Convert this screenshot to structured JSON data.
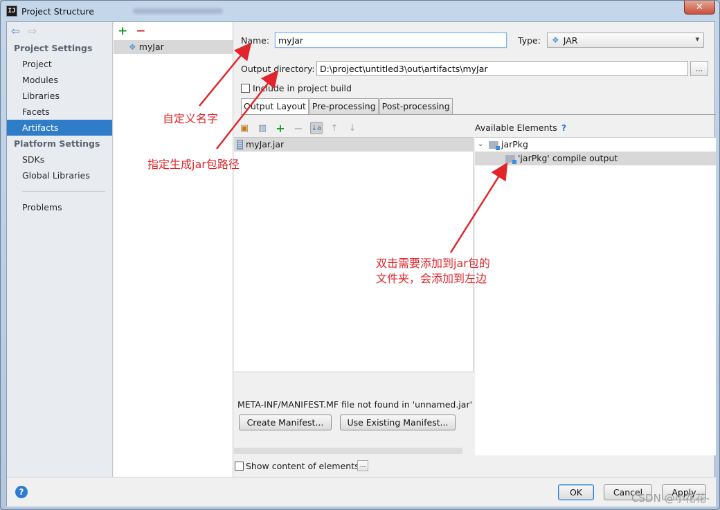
{
  "window": {
    "title": "Project Structure",
    "app_icon_text": "IJ",
    "close_glyph": "✕"
  },
  "nav": {
    "back_glyph": "⇦",
    "fwd_glyph": "⇨",
    "project_settings_header": "Project Settings",
    "project_items": [
      "Project",
      "Modules",
      "Libraries",
      "Facets",
      "Artifacts"
    ],
    "selected_item": "Artifacts",
    "platform_settings_header": "Platform Settings",
    "platform_items": [
      "SDKs",
      "Global Libraries"
    ],
    "problems": "Problems"
  },
  "artifacts": {
    "add_glyph": "+",
    "remove_glyph": "−",
    "items": [
      "myJar"
    ]
  },
  "form": {
    "name_label": "Name:",
    "name_value": "myJar",
    "type_label": "Type:",
    "type_value": "JAR",
    "output_dir_label": "Output directory:",
    "output_dir_value": "D:\\project\\untitled3\\out\\artifacts\\myJar",
    "browse_label": "...",
    "include_build_label": "Include in project build",
    "include_build_checked": false
  },
  "tabs": [
    "Output Layout",
    "Pre-processing",
    "Post-processing"
  ],
  "active_tab": "Output Layout",
  "output_layout": {
    "tree": [
      "myJar.jar"
    ],
    "manifest_warning": "META-INF/MANIFEST.MF file not found in 'unnamed.jar'",
    "create_manifest_button": "Create Manifest...",
    "use_existing_button": "Use Existing Manifest...",
    "show_content_label": "Show content of elements",
    "show_content_more": "..."
  },
  "available": {
    "header": "Available Elements",
    "help_glyph": "?",
    "expand_glyph": "⌄",
    "module": "jarPkg",
    "compile_output": "'jarPkg' compile output"
  },
  "buttons": {
    "ok": "OK",
    "cancel": "Cancel",
    "apply": "Apply",
    "help": "?"
  },
  "annotations": {
    "name_hint": "自定义名字",
    "path_hint": "指定生成jar包路径",
    "add_hint_line1": "双击需要添加到jar包的",
    "add_hint_line2": "文件夹，会添加到左边"
  },
  "watermark": "CSDN @小花花-",
  "colors": {
    "selection": "#2f7cc8",
    "annotation": "#e0262b",
    "add": "#1a9a2a",
    "remove": "#d12b2b"
  }
}
